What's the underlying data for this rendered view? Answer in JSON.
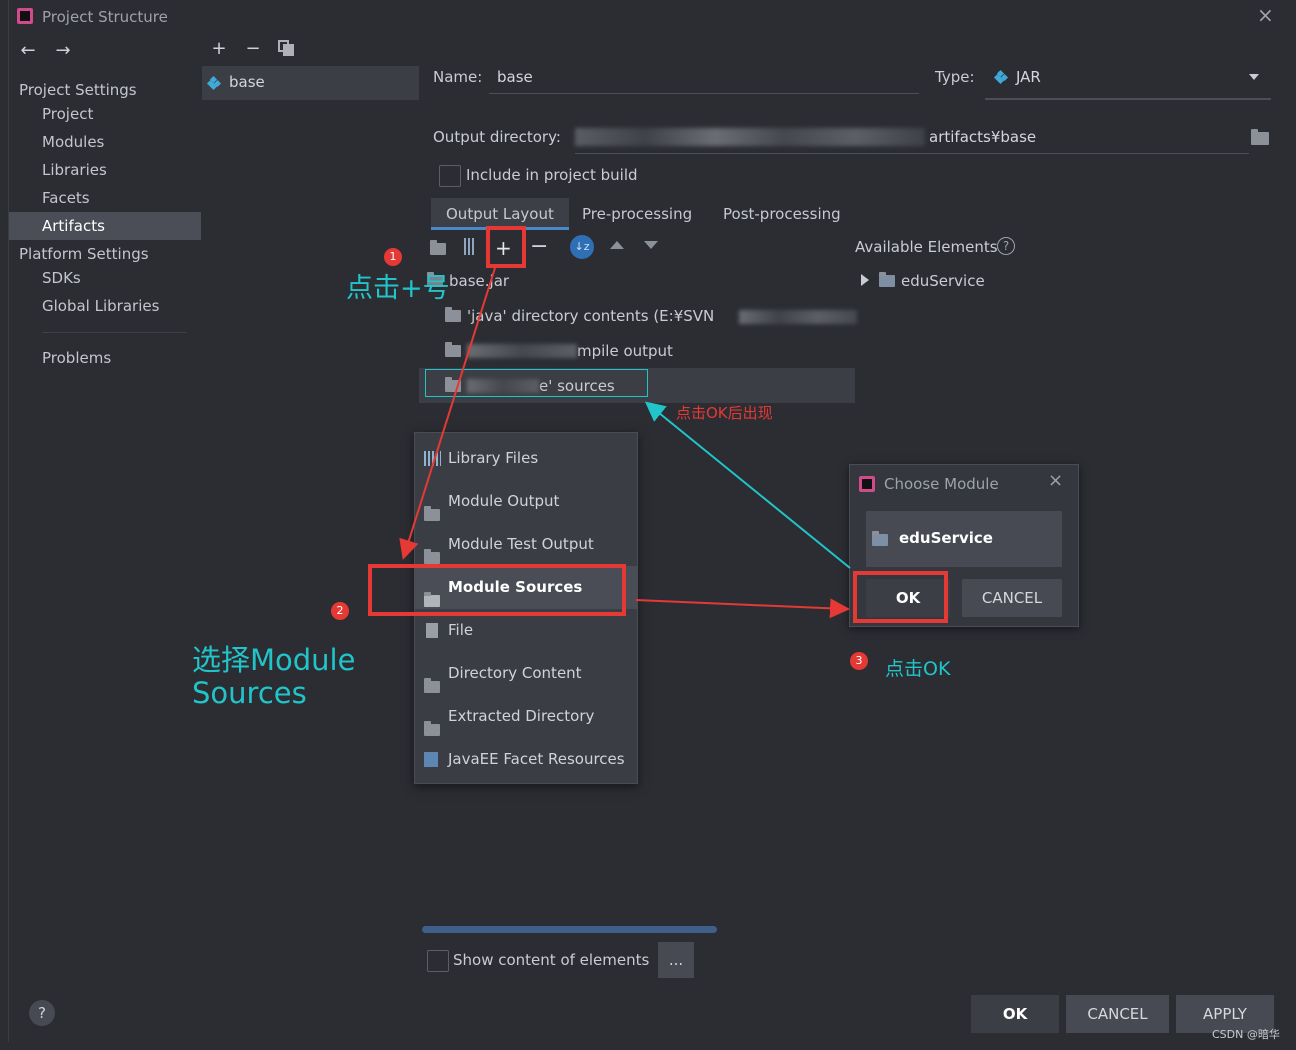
{
  "window": {
    "title": "Project Structure",
    "close_glyph": "×"
  },
  "nav": {
    "back": "←",
    "forward": "→"
  },
  "sidebar": {
    "project_settings_header": "Project Settings",
    "project_items": [
      "Project",
      "Modules",
      "Libraries",
      "Facets",
      "Artifacts"
    ],
    "selected_item": "Artifacts",
    "platform_settings_header": "Platform Settings",
    "platform_items": [
      "SDKs",
      "Global Libraries"
    ],
    "problems": "Problems",
    "help_glyph": "?"
  },
  "artifact_list": {
    "add": "+",
    "remove": "−",
    "items": [
      "base"
    ]
  },
  "form": {
    "name_label": "Name:",
    "name_value": "base",
    "type_label": "Type:",
    "type_value": "JAR",
    "output_dir_label": "Output directory:",
    "output_dir_value": "artifacts¥base",
    "include_build_label": "Include in project build"
  },
  "tabs": [
    "Output Layout",
    "Pre-processing",
    "Post-processing"
  ],
  "active_tab": "Output Layout",
  "layout_tree": {
    "root": "base.jar",
    "rows": [
      "'java' directory contents (E:¥SVN",
      "mpile output",
      "e' sources"
    ]
  },
  "available_elements": {
    "label": "Available Elements",
    "help_glyph": "?",
    "items": [
      "eduService"
    ]
  },
  "add_popup": {
    "items": [
      "Library Files",
      "Module Output",
      "Module Test Output",
      "Module Sources",
      "File",
      "Directory Content",
      "Extracted Directory",
      "JavaEE Facet Resources"
    ],
    "selected": "Module Sources"
  },
  "choose_module_dialog": {
    "title": "Choose Module",
    "close_glyph": "×",
    "module": "eduService",
    "ok": "OK",
    "cancel": "CANCEL"
  },
  "bottom": {
    "show_content_label": "Show content of elements",
    "more_button": "...",
    "ok": "OK",
    "cancel": "CANCEL",
    "apply": "APPLY"
  },
  "annotations": {
    "step1_badge": "1",
    "step1_text": "点击+号",
    "step2_badge": "2",
    "step2_text_line1": "选择Module",
    "step2_text_line2": "Sources",
    "step3_badge": "3",
    "step3_text": "点击OK",
    "appears_after_ok": "点击OK后出现"
  },
  "watermark": "CSDN @暗华",
  "colors": {
    "background": "#2b2d33",
    "selection": "#4b4e56",
    "accent_tab": "#4a88c7",
    "annotation_red": "#e53935",
    "annotation_cyan": "#21c5c9"
  }
}
